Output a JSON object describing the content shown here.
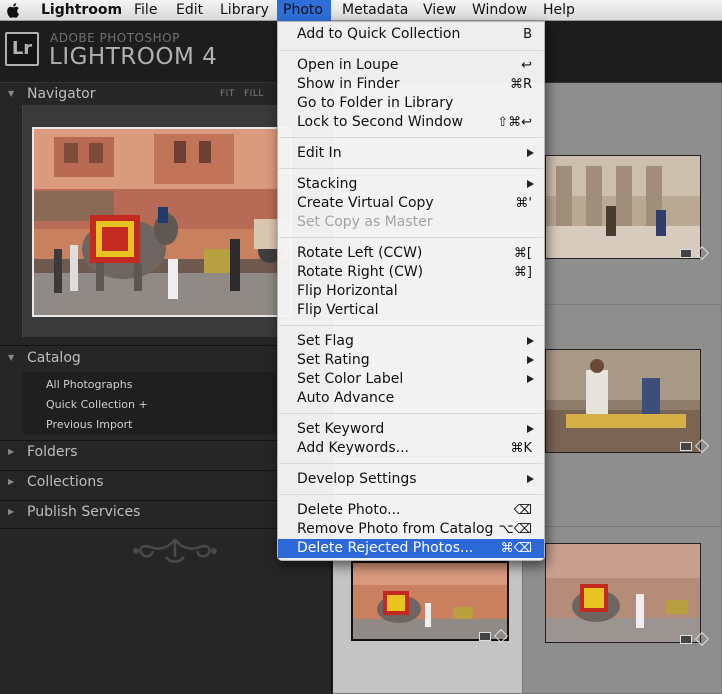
{
  "menubar": {
    "apple_icon": "apple-logo-icon",
    "items": [
      "Lightroom",
      "File",
      "Edit",
      "Library",
      "Photo",
      "Metadata",
      "View",
      "Window",
      "Help"
    ],
    "active": "Photo"
  },
  "identity": {
    "logo": "Lr",
    "brand_small": "ADOBE PHOTOSHOP",
    "brand_big": "LIGHTROOM 4"
  },
  "left_panel": {
    "navigator": {
      "title": "Navigator",
      "zoom_fit": "FIT",
      "zoom_fill": "FILL"
    },
    "catalog": {
      "title": "Catalog",
      "items": [
        "All Photographs",
        "Quick Collection  +",
        "Previous Import"
      ]
    },
    "folders": "Folders",
    "collections": "Collections",
    "publish_services": "Publish Services"
  },
  "photo_menu": {
    "groups": [
      [
        {
          "label": "Add to Quick Collection",
          "shortcut": "B"
        }
      ],
      [
        {
          "label": "Open in Loupe",
          "shortcut": "↩"
        },
        {
          "label": "Show in Finder",
          "shortcut": "⌘R"
        },
        {
          "label": "Go to Folder in Library",
          "shortcut": ""
        },
        {
          "label": "Lock to Second Window",
          "shortcut": "⇧⌘↩"
        }
      ],
      [
        {
          "label": "Edit In",
          "submenu": true
        }
      ],
      [
        {
          "label": "Stacking",
          "submenu": true
        },
        {
          "label": "Create Virtual Copy",
          "shortcut": "⌘'"
        },
        {
          "label": "Set Copy as Master",
          "shortcut": "",
          "disabled": true
        }
      ],
      [
        {
          "label": "Rotate Left (CCW)",
          "shortcut": "⌘["
        },
        {
          "label": "Rotate Right (CW)",
          "shortcut": "⌘]"
        },
        {
          "label": "Flip Horizontal",
          "shortcut": ""
        },
        {
          "label": "Flip Vertical",
          "shortcut": ""
        }
      ],
      [
        {
          "label": "Set Flag",
          "submenu": true
        },
        {
          "label": "Set Rating",
          "submenu": true
        },
        {
          "label": "Set Color Label",
          "submenu": true
        },
        {
          "label": "Auto Advance",
          "shortcut": ""
        }
      ],
      [
        {
          "label": "Set Keyword",
          "submenu": true
        },
        {
          "label": "Add Keywords...",
          "shortcut": "⌘K"
        }
      ],
      [
        {
          "label": "Develop Settings",
          "submenu": true
        }
      ],
      [
        {
          "label": "Delete Photo...",
          "shortcut": "⌫"
        },
        {
          "label": "Remove Photo from Catalog",
          "shortcut": "⌥⌫"
        },
        {
          "label": "Delete Rejected Photos...",
          "shortcut": "⌘⌫",
          "highlighted": true
        }
      ]
    ]
  },
  "colors": {
    "menu_highlight": "#2d68d8",
    "panel_bg": "#262626",
    "grid_bg": "#8b8b8b"
  }
}
